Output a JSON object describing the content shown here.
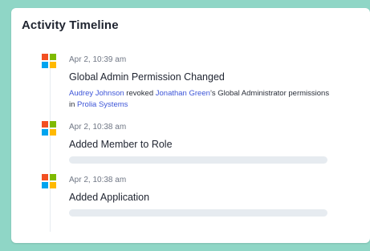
{
  "title": "Activity Timeline",
  "events": [
    {
      "time": "Apr 2, 10:39 am",
      "title": "Global Admin Permission Changed",
      "desc": {
        "actor": "Audrey Johnson",
        "text1": " revoked ",
        "target": "Jonathan Green",
        "text2": "’s Global Administrator permissions in ",
        "org": "Prolia Systems"
      }
    },
    {
      "time": "Apr 2, 10:38 am",
      "title": "Added Member to Role"
    },
    {
      "time": "Apr 2, 10:38 am",
      "title": "Added Application"
    }
  ],
  "colors": {
    "background": "#8fd6c6",
    "card": "#ffffff",
    "link": "#3d55d8",
    "placeholder": "#e6ebf0",
    "ms_red": "#f25022",
    "ms_green": "#7fba00",
    "ms_blue": "#00a4ef",
    "ms_yellow": "#ffb900"
  },
  "icons": {
    "event_icon": "microsoft-logo-icon"
  }
}
